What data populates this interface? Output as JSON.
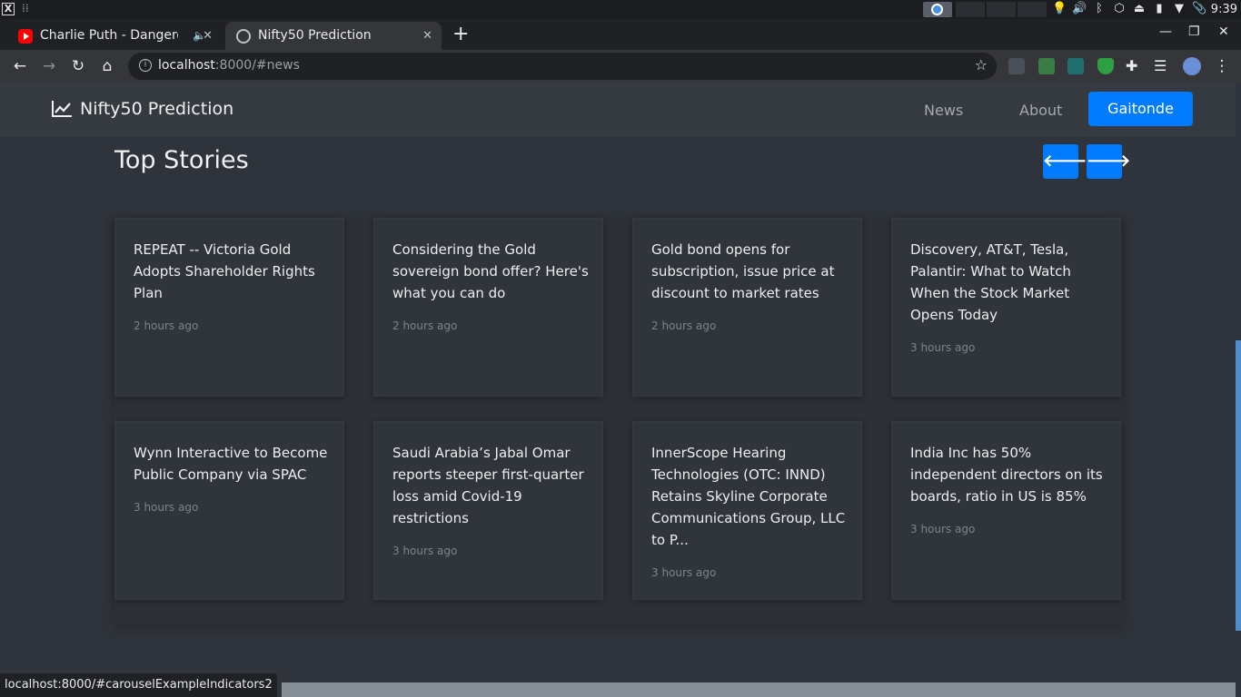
{
  "os": {
    "clock": "9:39"
  },
  "tabs": [
    {
      "title": "Charlie Puth - Dangerously",
      "favicon": "youtube-icon",
      "audio": true
    },
    {
      "title": "Nifty50 Prediction",
      "favicon": "globe-icon",
      "active": true
    }
  ],
  "address_bar": {
    "host": "localhost",
    "path": ":8000/#news"
  },
  "navbar": {
    "brand": "Nifty50 Prediction",
    "brand_icon": "line-chart-icon",
    "links": [
      "News",
      "About"
    ],
    "user_button": "Gaitonde",
    "accent": "#007bff"
  },
  "section": {
    "title": "Top Stories"
  },
  "cards": [
    {
      "headline": "REPEAT -- Victoria Gold Adopts Shareholder Rights Plan",
      "time": "2 hours ago"
    },
    {
      "headline": "Considering the Gold sovereign bond offer? Here's what you can do",
      "time": "2 hours ago"
    },
    {
      "headline": "Gold bond opens for subscription, issue price at discount to market rates",
      "time": "2 hours ago"
    },
    {
      "headline": "Discovery, AT&T, Tesla, Palantir: What to Watch When the Stock Market Opens Today",
      "time": "3 hours ago"
    },
    {
      "headline": "Wynn Interactive to Become Public Company via SPAC",
      "time": "3 hours ago"
    },
    {
      "headline": "Saudi Arabia’s Jabal Omar reports steeper first-quarter loss amid Covid-19 restrictions",
      "time": "3 hours ago"
    },
    {
      "headline": "InnerScope Hearing Technologies (OTC: INND) Retains Skyline Corporate Communications Group, LLC to P...",
      "time": "3 hours ago"
    },
    {
      "headline": "India Inc has 50% independent directors on its boards, ratio in US is 85%",
      "time": "3 hours ago"
    }
  ],
  "status_bar": {
    "url": "localhost:8000/#carouselExampleIndicators2"
  }
}
